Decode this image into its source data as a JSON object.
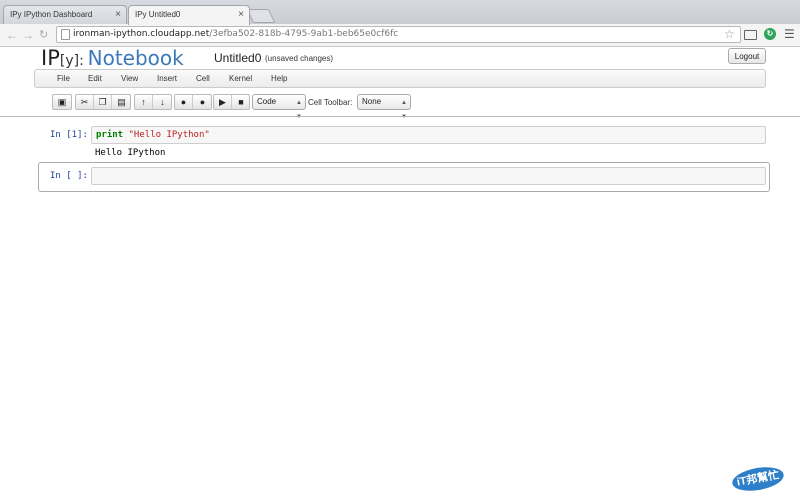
{
  "browser": {
    "tabs": [
      {
        "label": "IPy IPython Dashboard"
      },
      {
        "label": "IPy Untitled0"
      }
    ],
    "url_host": "ironman-ipython.cloudapp.net",
    "url_path": "/3efba502-818b-4795-9ab1-beb65e0cf6fc"
  },
  "notebook": {
    "logo_ip": "IP",
    "logo_y": "[y]:",
    "logo_notebook": "Notebook",
    "name": "Untitled0",
    "status": "(unsaved changes)",
    "logout_label": "Logout",
    "menu": [
      "File",
      "Edit",
      "View",
      "Insert",
      "Cell",
      "Kernel",
      "Help"
    ],
    "cell_type": "Code",
    "cell_toolbar_label": "Cell Toolbar:",
    "cell_toolbar_value": "None"
  },
  "cells": [
    {
      "prompt": "In [1]:",
      "code_keyword": "print",
      "code_string": "\"Hello IPython\"",
      "output": "Hello IPython"
    },
    {
      "prompt": "In [ ]:",
      "code": ""
    }
  ],
  "watermark": {
    "text": "iT邦幫忙"
  },
  "colors": {
    "accent": "#3b79b8",
    "prompt": "#1f3f92",
    "keyword": "#008000",
    "string": "#ba2121"
  }
}
